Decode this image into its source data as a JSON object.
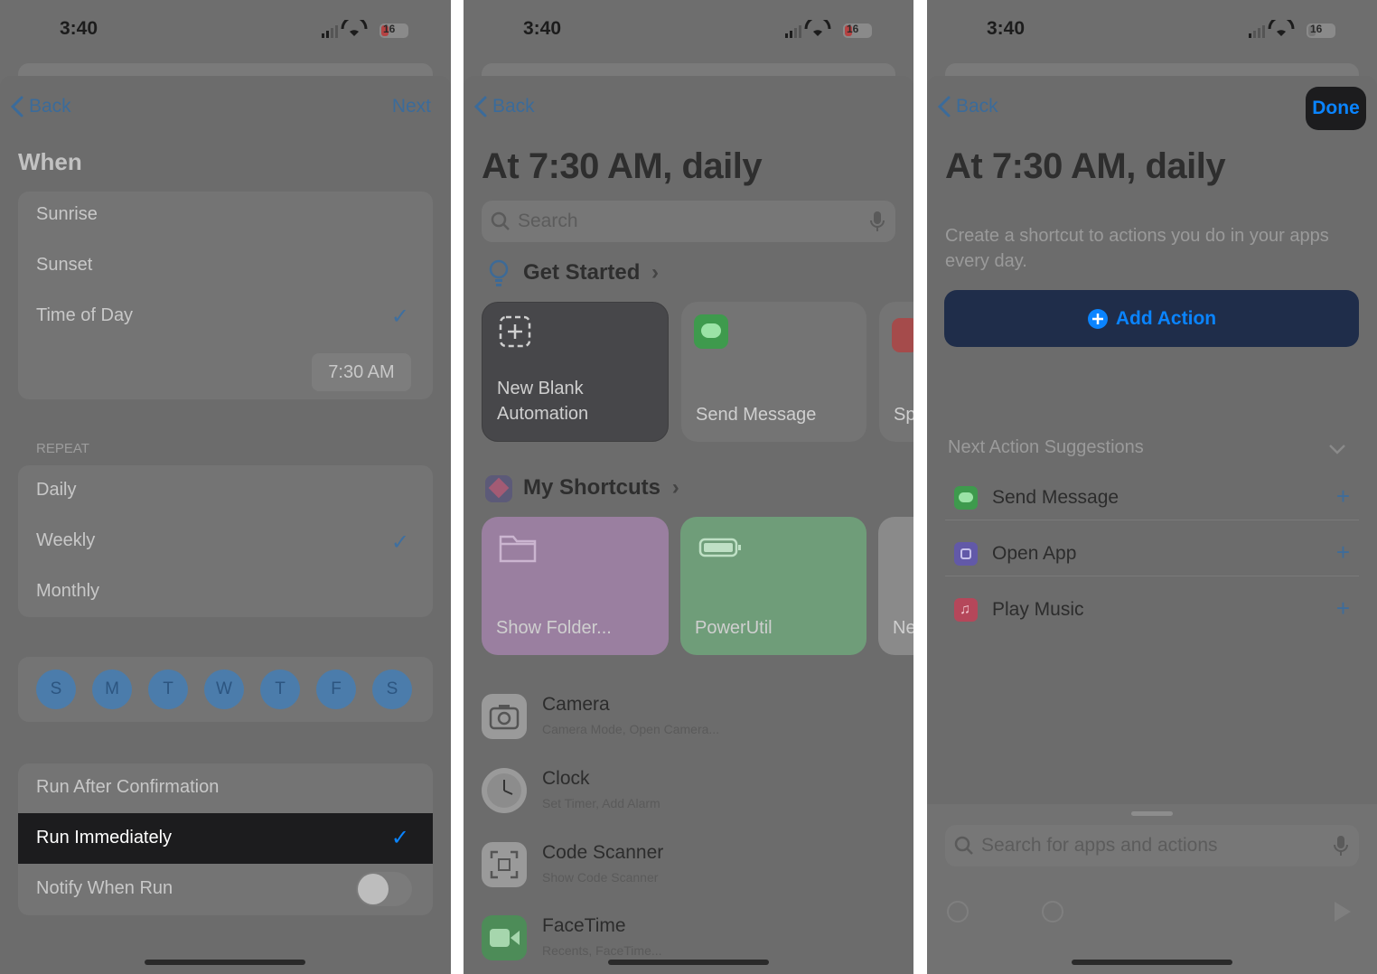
{
  "status": {
    "time": "3:40",
    "battery": "16"
  },
  "panel1": {
    "back": "Back",
    "next": "Next",
    "section_title": "When",
    "when_options": [
      "Sunrise",
      "Sunset",
      "Time of Day"
    ],
    "time_value": "7:30 AM",
    "repeat_header": "REPEAT",
    "repeat_options": [
      "Daily",
      "Weekly",
      "Monthly"
    ],
    "days": [
      "S",
      "M",
      "T",
      "W",
      "T",
      "F",
      "S"
    ],
    "run_options": [
      "Run After Confirmation",
      "Run Immediately",
      "Notify When Run"
    ]
  },
  "panel2": {
    "back": "Back",
    "title": "At 7:30 AM, daily",
    "search_placeholder": "Search",
    "get_started": "Get Started",
    "cards": [
      "New Blank Automation",
      "Send Message",
      "Sp"
    ],
    "my_shortcuts": "My Shortcuts",
    "shortcut_cards": [
      "Show Folder...",
      "PowerUtil",
      "Ne"
    ],
    "apps": [
      {
        "name": "Camera",
        "sub": "Camera Mode, Open Camera..."
      },
      {
        "name": "Clock",
        "sub": "Set Timer, Add Alarm"
      },
      {
        "name": "Code Scanner",
        "sub": "Show Code Scanner"
      },
      {
        "name": "FaceTime",
        "sub": "Recents, FaceTime..."
      }
    ]
  },
  "panel3": {
    "back": "Back",
    "done": "Done",
    "title": "At 7:30 AM, daily",
    "description": "Create a shortcut to actions you do in your apps every day.",
    "add_action": "Add Action",
    "suggestions_header": "Next Action Suggestions",
    "suggestions": [
      "Send Message",
      "Open App",
      "Play Music"
    ],
    "search_placeholder": "Search for apps and actions"
  },
  "colors": {
    "accent": "#0a84ff",
    "dim_overlay": "#6e6e6e",
    "done_bg": "#1c1c1e",
    "add_action_bg": "#1f2d4a"
  }
}
